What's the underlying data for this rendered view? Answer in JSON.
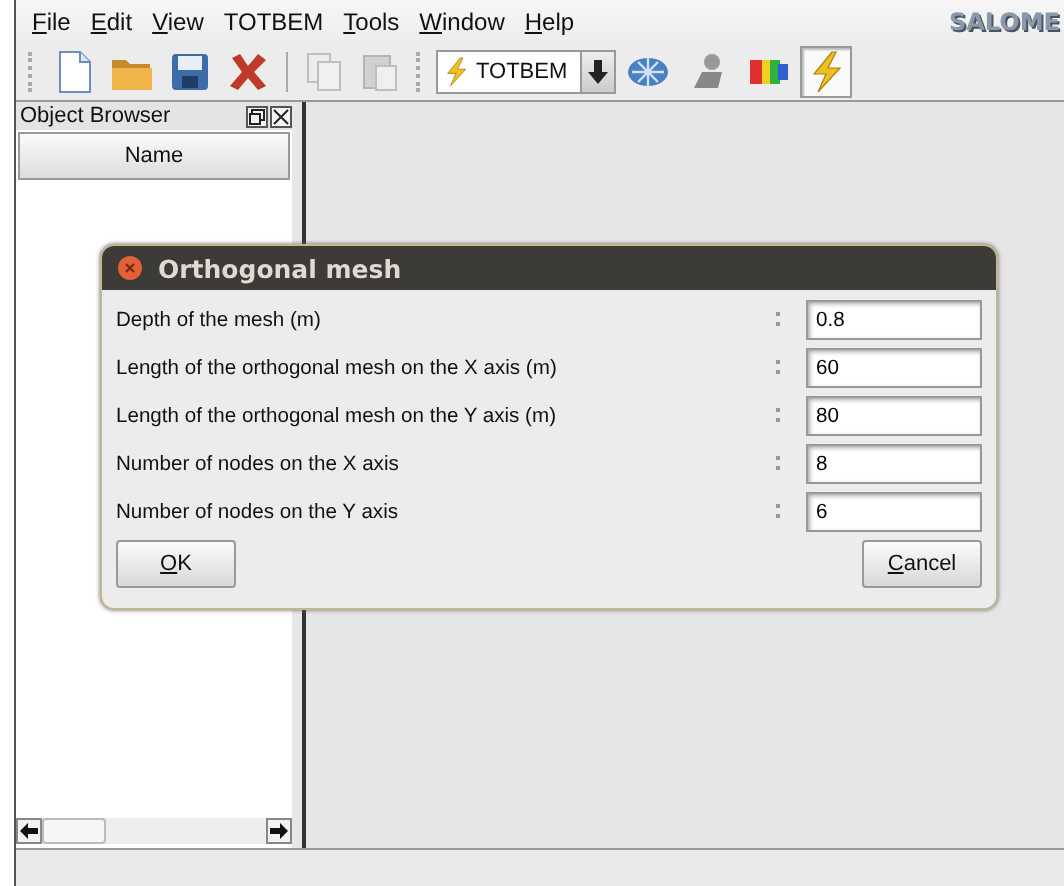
{
  "menu_bar": {
    "items": [
      {
        "label": "File",
        "mnemonic": true
      },
      {
        "label": "Edit",
        "mnemonic": true
      },
      {
        "label": "View",
        "mnemonic": true
      },
      {
        "label": "TOTBEM",
        "mnemonic": false
      },
      {
        "label": "Tools",
        "mnemonic": true
      },
      {
        "label": "Window",
        "mnemonic": true
      },
      {
        "label": "Help",
        "mnemonic": true
      }
    ],
    "logo": "SALOME"
  },
  "toolbar": {
    "file_buttons": [
      {
        "kind": "new",
        "disabled": false
      },
      {
        "kind": "open",
        "disabled": false
      },
      {
        "kind": "save",
        "disabled": false
      },
      {
        "kind": "close",
        "disabled": false
      },
      {
        "kind": "copy",
        "disabled": true
      },
      {
        "kind": "paste",
        "disabled": true
      }
    ],
    "module_combo": {
      "value": "TOTBEM"
    },
    "module_buttons": [
      {
        "kind": "mesh",
        "pressed": false
      },
      {
        "kind": "figure",
        "pressed": false
      },
      {
        "kind": "rainbow",
        "pressed": false
      },
      {
        "kind": "bolt",
        "pressed": true
      }
    ]
  },
  "object_browser": {
    "title": "Object Browser",
    "columns": [
      "Name"
    ]
  },
  "dialog": {
    "title": "Orthogonal mesh",
    "fields": [
      {
        "label": "Depth of the mesh (m)",
        "value": "0.8"
      },
      {
        "label": "Length of the orthogonal mesh on the X axis (m)",
        "value": "60"
      },
      {
        "label": "Length of the orthogonal mesh on the Y axis (m)",
        "value": "80"
      },
      {
        "label": "Number of nodes on the X axis",
        "value": "8"
      },
      {
        "label": "Number of nodes on the Y axis",
        "value": "6"
      }
    ],
    "buttons": [
      {
        "label": "OK",
        "mnemonic": true
      },
      {
        "label": "Cancel",
        "mnemonic": true
      }
    ]
  }
}
